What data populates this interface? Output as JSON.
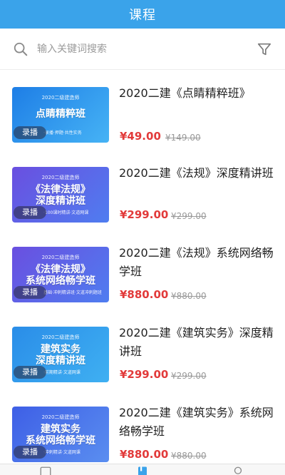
{
  "header": {
    "title": "课程"
  },
  "search": {
    "placeholder": "输入关键词搜索"
  },
  "courses": [
    {
      "title": "2020二建《点睛精粹班》",
      "price": "¥49.00",
      "original_price": "¥149.00",
      "badge": "录播",
      "thumb_top": "2020二级建造师",
      "thumb_main": "点睛精粹班",
      "thumb_sub": "·录播·押题·共性实务",
      "thumb_color": "#2b86e8"
    },
    {
      "title": "2020二建《法规》深度精讲班",
      "price": "¥299.00",
      "original_price": "¥299.00",
      "badge": "录播",
      "thumb_top": "2020二级建造师",
      "thumb_main": "《法律法规》\n深度精讲班",
      "thumb_sub": "·100课时精讲·文道网课",
      "thumb_color": "#5a5ee6"
    },
    {
      "title": "2020二建《法规》系统网络畅学班",
      "price": "¥880.00",
      "original_price": "¥880.00",
      "badge": "录播",
      "thumb_top": "2020二级建造师",
      "thumb_main": "《法律法规》\n系统网络畅学班",
      "thumb_sub": "基础·冲刺精讲班·文道冲刺题班",
      "thumb_color": "#5a5ee6"
    },
    {
      "title": "2020二建《建筑实务》深度精讲班",
      "price": "¥299.00",
      "original_price": "¥299.00",
      "badge": "录播",
      "thumb_top": "2020二级建造师",
      "thumb_main": "建筑实务\n深度精讲班",
      "thumb_sub": "·前期精讲·文道网课",
      "thumb_color": "#2a93ea"
    },
    {
      "title": "2020二建《建筑实务》系统网络畅学班",
      "price": "¥880.00",
      "original_price": "¥880.00",
      "badge": "录播",
      "thumb_top": "2020二级建造师",
      "thumb_main": "建筑实务\n系统网络畅学班",
      "thumb_sub": "·冲刺精讲·文道网课",
      "thumb_color": "#4a6be8"
    }
  ],
  "tabbar": {
    "tabs": [
      {
        "name": "home-icon"
      },
      {
        "name": "course-icon",
        "active_color": "#3aa3ea"
      },
      {
        "name": "profile-icon"
      }
    ]
  },
  "colors": {
    "primary": "#3aa3ea",
    "price": "#e23a3a"
  }
}
